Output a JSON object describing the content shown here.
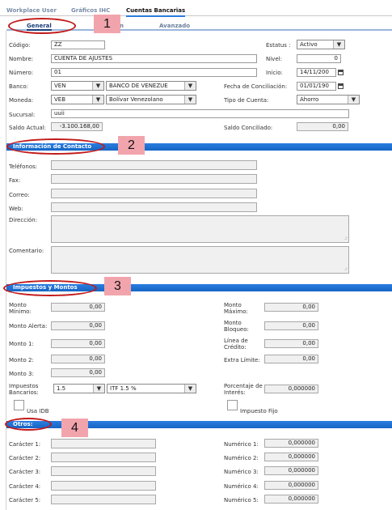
{
  "top_tabs": [
    "Workplace User",
    "Gráficos IHC",
    "Cuentas Bancarias"
  ],
  "sub_tabs": [
    "General",
    "n",
    "Avanzado"
  ],
  "badges": [
    "1",
    "2",
    "3",
    "4"
  ],
  "general": {
    "codigo_label": "Código:",
    "codigo_value": "ZZ",
    "estatus_label": "Estatus :",
    "estatus_value": "Activo",
    "nombre_label": "Nombre:",
    "nombre_value": "CUENTA DE AJUSTES",
    "nivel_label": "Nivel:",
    "nivel_value": "0",
    "numero_label": "Número:",
    "numero_value": "01",
    "inicio_label": "Inicio:",
    "inicio_value": "14/11/200",
    "banco_label": "Banco:",
    "banco_code": "VEN",
    "banco_name": "BANCO DE VENEZUE",
    "fecha_conc_label": "Fecha de Conciliación:",
    "fecha_conc_value": "01/01/190",
    "moneda_label": "Moneda:",
    "moneda_code": "VEB",
    "moneda_name": "Bolívar Venezolano",
    "tipo_label": "Tipo de Cuenta:",
    "tipo_value": "Ahorro",
    "sucursal_label": "Sucursal:",
    "sucursal_value": "uuii",
    "saldo_actual_label": "Saldo Actual:",
    "saldo_actual_value": "-3.100.168,00",
    "saldo_conc_label": "Saldo Conciliado:",
    "saldo_conc_value": "0,00"
  },
  "contacto": {
    "title": "Información de Contacto",
    "telefonos_label": "Teléfonos:",
    "fax_label": "Fax:",
    "correo_label": "Correo:",
    "web_label": "Web:",
    "direccion_label": "Dirección:",
    "comentario_label": "Comentario:"
  },
  "impuestos": {
    "title": "Impuestos y Montos",
    "monto_minimo_label": "Monto Mínimo:",
    "monto_minimo_value": "0,00",
    "monto_maximo_label": "Monto Máximo:",
    "monto_maximo_value": "0,00",
    "monto_alerta_label": "Monto Alerta:",
    "monto_alerta_value": "0,00",
    "monto_bloqueo_label": "Monto Bloqueo:",
    "monto_bloqueo_value": "0,00",
    "monto1_label": "Monto 1:",
    "monto1_value": "0,00",
    "linea_credito_label": "Línea de Crédito:",
    "linea_credito_value": "0,00",
    "monto2_label": "Monto 2:",
    "monto2_value": "0,00",
    "extra_limite_label": "Extra Límite:",
    "extra_limite_value": "0,00",
    "monto3_label": "Monto 3:",
    "monto3_value": "0,00",
    "impuestos_bancarios_label": "Impuestos Bancarios:",
    "impuestos_code": "1.5",
    "impuestos_name": "ITF 1.5 %",
    "porcentaje_label": "Porcentaje de Interés:",
    "porcentaje_value": "0,000000",
    "usa_idb_label": "Usa IDB",
    "impuesto_fijo_label": "Impuesto Fijo"
  },
  "otros": {
    "title": "Otros:",
    "caracter_labels": [
      "Carácter 1:",
      "Carácter 2:",
      "Carácter 3:",
      "Carácter 4:",
      "Carácter 5:"
    ],
    "numerico_labels": [
      "Numérico 1:",
      "Numérico 2:",
      "Numérico 3:",
      "Numérico 4:",
      "Numérico 5:"
    ],
    "numerico_values": [
      "0,000000",
      "0,000000",
      "0,000000",
      "0,000000",
      "0,000000"
    ]
  },
  "icons": {
    "dropdown": "▼",
    "calendar": "calendar-icon",
    "grip": "resize-grip-icon"
  }
}
